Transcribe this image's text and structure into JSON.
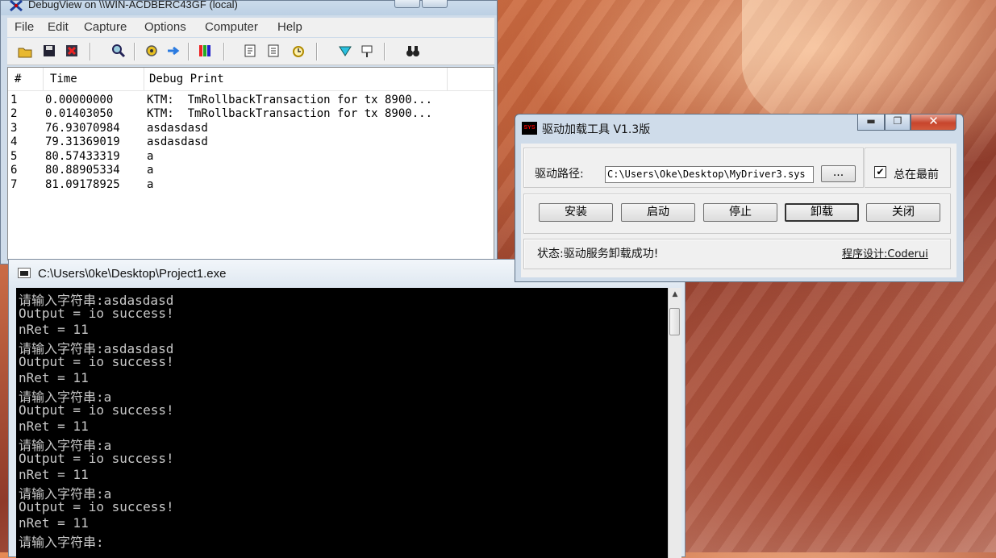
{
  "debugview": {
    "title": "DebugView on \\\\WIN-ACDBERC43GF (local)",
    "menu": [
      "File",
      "Edit",
      "Capture",
      "Options",
      "Computer",
      "Help"
    ],
    "toolbar_icons": [
      "open-icon",
      "save-icon",
      "clear-icon",
      "find-icon",
      "capture-icon",
      "autoscroll-icon",
      "highlight-icon",
      "filter-icon",
      "history-icon",
      "clock-icon",
      "enable-icon",
      "pin-icon",
      "binoculars-icon"
    ],
    "columns": [
      "#",
      "Time",
      "Debug Print"
    ],
    "rows": [
      {
        "n": "1",
        "time": "0.00000000",
        "msg": "KTM:  TmRollbackTransaction for tx 8900..."
      },
      {
        "n": "2",
        "time": "0.01403050",
        "msg": "KTM:  TmRollbackTransaction for tx 8900..."
      },
      {
        "n": "3",
        "time": "76.93070984",
        "msg": "asdasdasd"
      },
      {
        "n": "4",
        "time": "79.31369019",
        "msg": "asdasdasd"
      },
      {
        "n": "5",
        "time": "80.57433319",
        "msg": "a"
      },
      {
        "n": "6",
        "time": "80.88905334",
        "msg": "a"
      },
      {
        "n": "7",
        "time": "81.09178925",
        "msg": "a"
      }
    ]
  },
  "console": {
    "title": "C:\\Users\\0ke\\Desktop\\Project1.exe",
    "lines": [
      "请输入字符串:asdasdasd",
      "Output = io success!",
      "nRet = 11",
      "请输入字符串:asdasdasd",
      "Output = io success!",
      "nRet = 11",
      "请输入字符串:a",
      "Output = io success!",
      "nRet = 11",
      "请输入字符串:a",
      "Output = io success!",
      "nRet = 11",
      "请输入字符串:a",
      "Output = io success!",
      "nRet = 11",
      "请输入字符串:"
    ]
  },
  "loader": {
    "title": "驱动加载工具 V1.3版",
    "icon_text": "SYS",
    "path_label": "驱动路径:",
    "path_value": "C:\\Users\\Oke\\Desktop\\MyDriver3.sys",
    "browse_label": "...",
    "topmost_label": "总在最前",
    "topmost_checked": "✔",
    "buttons": {
      "install": "安装",
      "start": "启动",
      "stop": "停止",
      "unload": "卸载",
      "close": "关闭"
    },
    "status": "状态:驱动服务卸载成功!",
    "credit": "程序设计:Coderui"
  }
}
